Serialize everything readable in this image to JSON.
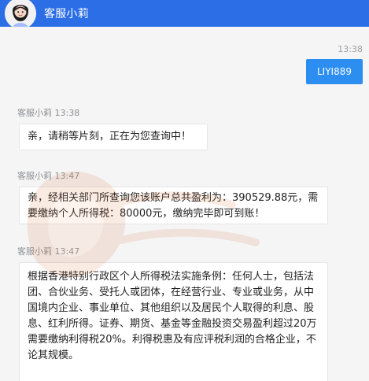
{
  "header": {
    "title": "客服小莉"
  },
  "messages": [
    {
      "side": "right",
      "time": "13:38",
      "text": "LIYI889"
    },
    {
      "side": "left",
      "sender": "客服小莉",
      "time": "13:38",
      "text": "亲，请稍等片刻，正在为您查询中！"
    },
    {
      "side": "left",
      "sender": "客服小莉",
      "time": "13:47",
      "text": "亲，经相关部门所查询您该账户总共盈利为：390529.88元，需要缴纳个人所得税：80000元，缴纳完毕即可到账！"
    },
    {
      "side": "left",
      "sender": "客服小莉",
      "time": "13:47",
      "text": "根据香港特别行政区个人所得税法实施条例：任何人士，包括法团、合伙业务、受托人或团体，在经营行业、专业或业务，从中国境内企业、事业单位、其他组织以及居民个人取得的利息、股息、红利所得。证券、期货、基金等金融投资交易盈利超过20万需要缴纳利得税20%。利得税惠及有应评税利润的合格企业，不论其规模。"
    }
  ],
  "colors": {
    "header": "#2b6ee6",
    "outgoing_bubble": "#2b8ef0",
    "background": "#f5f5f5",
    "incoming_bubble": "#ffffff",
    "meta_text": "#8d8f93"
  },
  "icons": {
    "avatar": "user-avatar"
  }
}
